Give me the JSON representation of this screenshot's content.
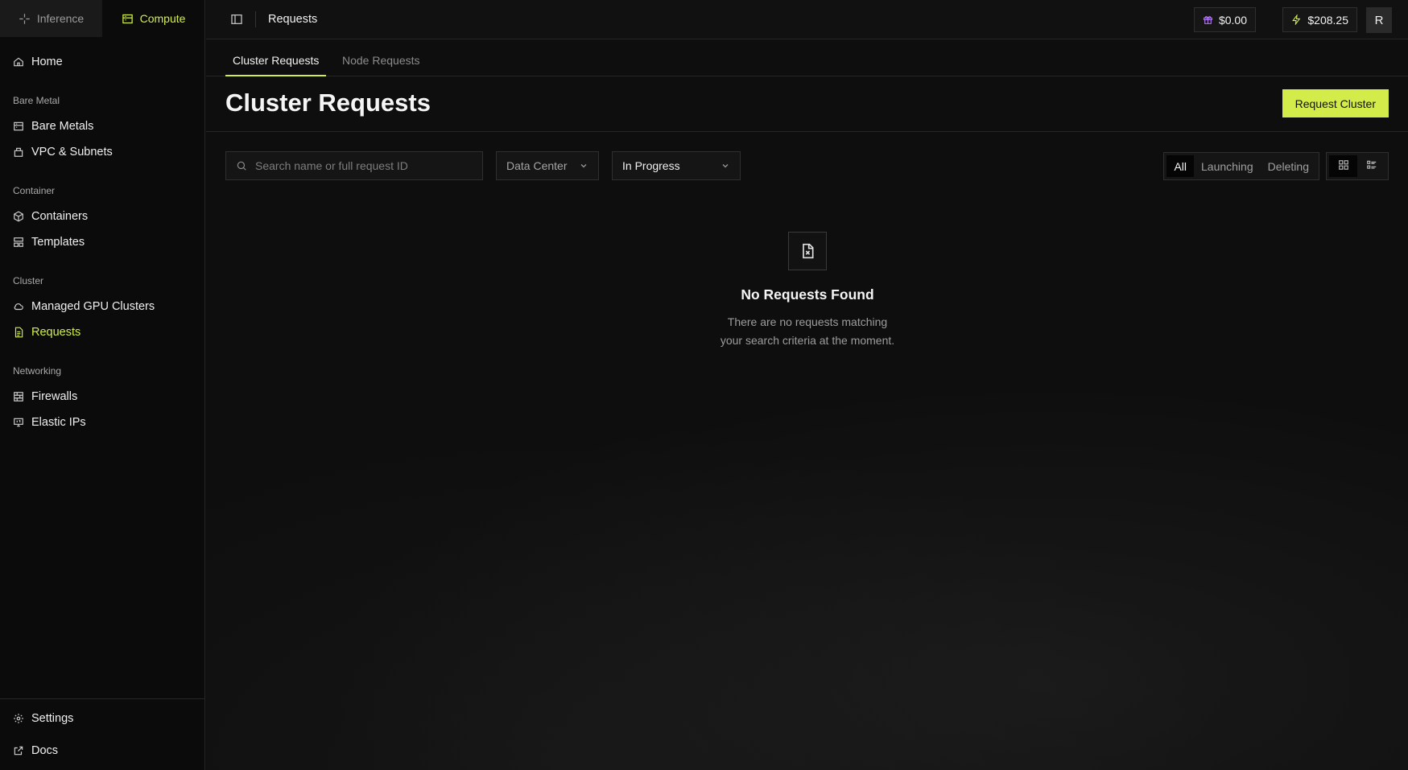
{
  "sidebar": {
    "modes": [
      {
        "label": "Inference",
        "icon": "sparkle-icon"
      },
      {
        "label": "Compute",
        "icon": "server-icon"
      }
    ],
    "home": {
      "label": "Home",
      "icon": "home-icon"
    },
    "sections": [
      {
        "label": "Bare Metal",
        "items": [
          {
            "label": "Bare Metals",
            "icon": "server-icon"
          },
          {
            "label": "VPC & Subnets",
            "icon": "network-icon"
          }
        ]
      },
      {
        "label": "Container",
        "items": [
          {
            "label": "Containers",
            "icon": "cube-icon"
          },
          {
            "label": "Templates",
            "icon": "template-icon"
          }
        ]
      },
      {
        "label": "Cluster",
        "items": [
          {
            "label": "Managed GPU Clusters",
            "icon": "cloud-icon"
          },
          {
            "label": "Requests",
            "icon": "file-list-icon",
            "active": true
          }
        ]
      },
      {
        "label": "Networking",
        "items": [
          {
            "label": "Firewalls",
            "icon": "firewall-icon"
          },
          {
            "label": "Elastic IPs",
            "icon": "monitor-icon"
          }
        ]
      }
    ],
    "footer": [
      {
        "label": "Settings",
        "icon": "gear-icon"
      },
      {
        "label": "Docs",
        "icon": "external-link-icon"
      }
    ]
  },
  "header": {
    "title": "Requests",
    "credits": [
      {
        "value": "$0.00",
        "icon": "gift-icon",
        "color": "#b57cf5"
      },
      {
        "value": "$208.25",
        "icon": "lightning-icon",
        "color": "#d4ec4a"
      }
    ],
    "avatar": "R"
  },
  "tabs": [
    {
      "label": "Cluster Requests",
      "active": true
    },
    {
      "label": "Node Requests",
      "active": false
    }
  ],
  "page": {
    "title": "Cluster Requests",
    "primary_button": "Request Cluster"
  },
  "filters": {
    "search_placeholder": "Search name or full request ID",
    "data_center": "Data Center",
    "status": "In Progress",
    "segments": [
      {
        "label": "All",
        "active": true
      },
      {
        "label": "Launching",
        "active": false
      },
      {
        "label": "Deleting",
        "active": false
      }
    ],
    "view_modes": [
      {
        "icon": "grid-icon",
        "active": true
      },
      {
        "icon": "list-icon",
        "active": false
      }
    ]
  },
  "empty_state": {
    "icon": "file-x-icon",
    "title": "No Requests Found",
    "line1": "There are no requests matching",
    "line2": "your search criteria at the moment."
  },
  "colors": {
    "accent": "#d4ec4a",
    "background": "#0e0e0e"
  }
}
